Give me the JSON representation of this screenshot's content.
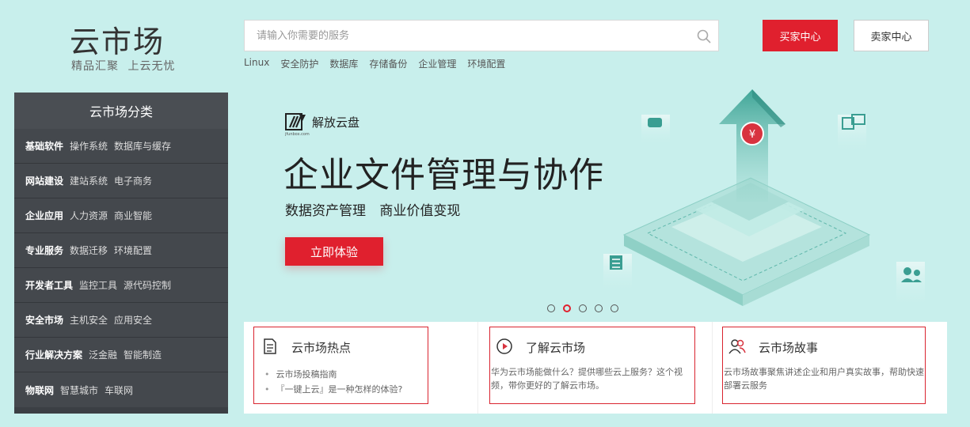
{
  "header": {
    "logo_title": "云市场",
    "logo_sub": "精品汇聚 上云无忧",
    "search_placeholder": "请输入你需要的服务",
    "hot_links": [
      "Linux",
      "安全防护",
      "数据库",
      "存储备份",
      "企业管理",
      "环境配置"
    ],
    "buyer_center": "买家中心",
    "seller_center": "卖家中心"
  },
  "sidebar": {
    "title": "云市场分类",
    "categories": [
      {
        "main": "基础软件",
        "subs": [
          "操作系统",
          "数据库与缓存"
        ]
      },
      {
        "main": "网站建设",
        "subs": [
          "建站系统",
          "电子商务"
        ]
      },
      {
        "main": "企业应用",
        "subs": [
          "人力资源",
          "商业智能"
        ]
      },
      {
        "main": "专业服务",
        "subs": [
          "数据迁移",
          "环境配置"
        ]
      },
      {
        "main": "开发者工具",
        "subs": [
          "监控工具",
          "源代码控制"
        ]
      },
      {
        "main": "安全市场",
        "subs": [
          "主机安全",
          "应用安全"
        ]
      },
      {
        "main": "行业解决方案",
        "subs": [
          "泛金融",
          "智能制造"
        ]
      },
      {
        "main": "物联网",
        "subs": [
          "智慧城市",
          "车联网"
        ]
      }
    ]
  },
  "banner": {
    "brand_name": "解放云盘",
    "brand_url": "jfunbox.com",
    "title": "企业文件管理与协作",
    "subtitle": "数据资产管理 商业价值变现",
    "cta": "立即体验",
    "slide_count": 5,
    "active_slide": 2
  },
  "cards": [
    {
      "title": "云市场热点",
      "icon": "document-icon",
      "items": [
        "云市场投稿指南",
        "『一键上云』是一种怎样的体验?"
      ]
    },
    {
      "title": "了解云市场",
      "icon": "play-icon",
      "desc": "华为云市场能做什么？提供哪些云上服务？这个视频，带你更好的了解云市场。"
    },
    {
      "title": "云市场故事",
      "icon": "users-icon",
      "desc": "云市场故事聚焦讲述企业和用户真实故事，帮助快速部署云服务"
    }
  ],
  "colors": {
    "accent": "#e0202e",
    "background": "#c8efec",
    "sidebar": "#3b3f44",
    "teal": "#3a9e92"
  }
}
